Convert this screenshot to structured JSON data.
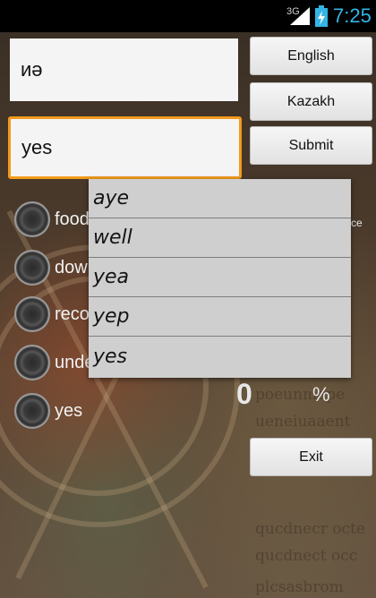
{
  "status_bar": {
    "network": "3G",
    "time": "7:25",
    "icons": [
      "signal-icon",
      "battery-charging-icon"
    ]
  },
  "source_field": {
    "value": "иə"
  },
  "target_field": {
    "value": "yes"
  },
  "buttons": {
    "english": "English",
    "kazakh": "Kazakh",
    "submit": "Submit",
    "exit": "Exit"
  },
  "options": [
    {
      "label": "food"
    },
    {
      "label": "down"
    },
    {
      "label": "record"
    },
    {
      "label": "under"
    },
    {
      "label": "yes"
    }
  ],
  "suggestions": [
    "aye",
    "well",
    "yea",
    "yep",
    "yes"
  ],
  "hidden_text": "ce",
  "score": {
    "value": "0",
    "unit": "%"
  },
  "colors": {
    "focus_border": "#f29b1e",
    "status_time": "#33b5e5",
    "dropdown_bg": "#cfcfcf"
  }
}
